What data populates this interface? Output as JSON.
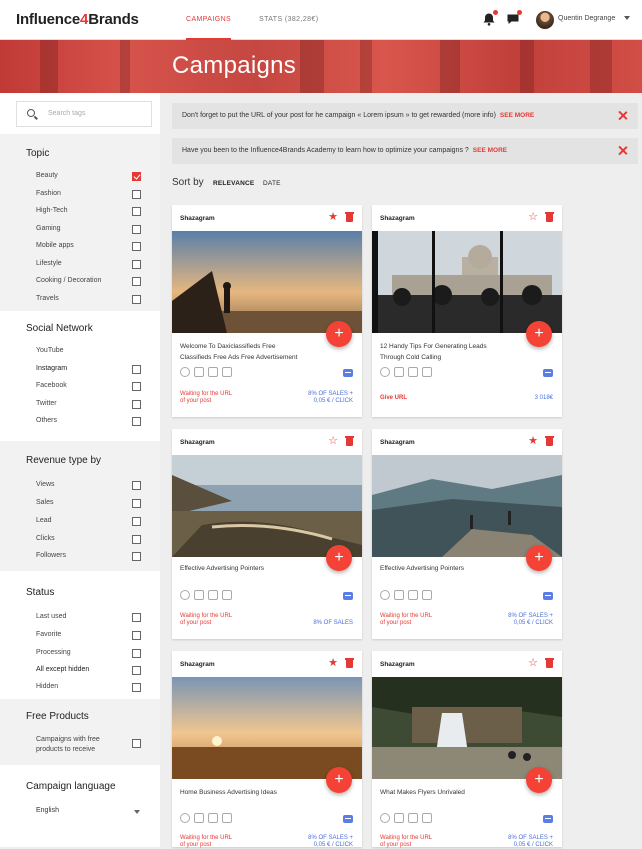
{
  "app": {
    "logo_text": "Influence",
    "logo_four": "4",
    "logo_text2": "Brands",
    "user_name": "Quentin Degrange"
  },
  "nav": {
    "tab_campaigns": "CAMPAIGNS",
    "tab_stats": "STATS (382,28€)"
  },
  "hero": {
    "title": "Campaigns"
  },
  "colors": {
    "accent": "#e53935",
    "link_blue": "#4a6fd8"
  },
  "search": {
    "placeholder": "Search tags"
  },
  "filters": {
    "topic": {
      "title": "Topic",
      "items": [
        {
          "label": "Beauty",
          "checked": true
        },
        {
          "label": "Fashion",
          "checked": false
        },
        {
          "label": "High-Tech",
          "checked": false
        },
        {
          "label": "Gaming",
          "checked": false
        },
        {
          "label": "Mobile apps",
          "checked": false
        },
        {
          "label": "Lifestyle",
          "checked": false
        },
        {
          "label": "Cooking / Decoration",
          "checked": false
        },
        {
          "label": "Travels",
          "checked": false
        }
      ]
    },
    "social": {
      "title": "Social Network",
      "items": [
        {
          "label": "YouTube",
          "checked": false
        },
        {
          "label": "Instagram",
          "checked": false
        },
        {
          "label": "Facebook",
          "checked": false
        },
        {
          "label": "Twitter",
          "checked": false
        },
        {
          "label": "Others",
          "checked": false
        }
      ]
    },
    "revenue": {
      "title": "Revenue type by",
      "items": [
        {
          "label": "Views",
          "checked": false
        },
        {
          "label": "Sales",
          "checked": false
        },
        {
          "label": "Lead",
          "checked": false
        },
        {
          "label": "Clicks",
          "checked": false
        },
        {
          "label": "Followers",
          "checked": false
        }
      ]
    },
    "status": {
      "title": "Status",
      "items": [
        {
          "label": "Last used",
          "checked": false
        },
        {
          "label": "Favorite",
          "checked": false
        },
        {
          "label": "Processing",
          "checked": false
        },
        {
          "label": "All except hidden",
          "checked": false
        },
        {
          "label": "Hidden",
          "checked": false
        }
      ]
    },
    "free": {
      "title": "Free Products",
      "label_line1": "Campaigns with free",
      "label_line2": "products to receive"
    },
    "language": {
      "title": "Campaign language",
      "selected": "English"
    }
  },
  "notices": [
    {
      "text": "Don't forget to put the URL of your post for he campaign « Lorem ipsum » to get rewarded (more info)",
      "link": "SEE MORE"
    },
    {
      "text": "Have you been to the Influence4Brands Academy to learn how to optimize your campaigns ?",
      "link": "SEE MORE"
    }
  ],
  "sort": {
    "label": "Sort by",
    "options": [
      "RELEVANCE",
      "DATE"
    ],
    "active": "RELEVANCE"
  },
  "cards": [
    {
      "brand": "Shazagram",
      "favorite": true,
      "title_line1": "Welcome To Daxiclassifieds Free",
      "title_line2": "Classifieds Free Ads Free Advertisement",
      "status_line1": "Waiting for the URL",
      "status_line2": "of your post",
      "rev_line1": "8% OF SALES +",
      "rev_line2": "0,05 € / CLICK"
    },
    {
      "brand": "Shazagram",
      "favorite": false,
      "title_line1": "12 Handy Tips For Generating Leads",
      "title_line2": "Through Cold Calling",
      "status_line1": "Give URL",
      "status_line2": "",
      "rev_line1": "3 018€",
      "rev_line2": ""
    },
    {
      "brand": "Shazagram",
      "favorite": false,
      "title_line1": "Effective Advertising Pointers",
      "title_line2": "",
      "status_line1": "Waiting for the URL",
      "status_line2": "of your post",
      "rev_line1": "8% OF SALES",
      "rev_line2": ""
    },
    {
      "brand": "Shazagram",
      "favorite": true,
      "title_line1": "Effective Advertising Pointers",
      "title_line2": "",
      "status_line1": "Waiting for the URL",
      "status_line2": "of your post",
      "rev_line1": "8% OF SALES +",
      "rev_line2": "0,05 € / CLICK"
    },
    {
      "brand": "Shazagram",
      "favorite": true,
      "title_line1": "Home Business Advertising Ideas",
      "title_line2": "",
      "status_line1": "Waiting for the URL",
      "status_line2": "of your post",
      "rev_line1": "8% OF SALES +",
      "rev_line2": "0,05 € / CLICK"
    },
    {
      "brand": "Shazagram",
      "favorite": false,
      "title_line1": "What Makes Flyers Unrivaled",
      "title_line2": "",
      "status_line1": "Waiting for the URL",
      "status_line2": "of your post",
      "rev_line1": "8% OF SALES +",
      "rev_line2": "0,05 € / CLICK"
    }
  ]
}
